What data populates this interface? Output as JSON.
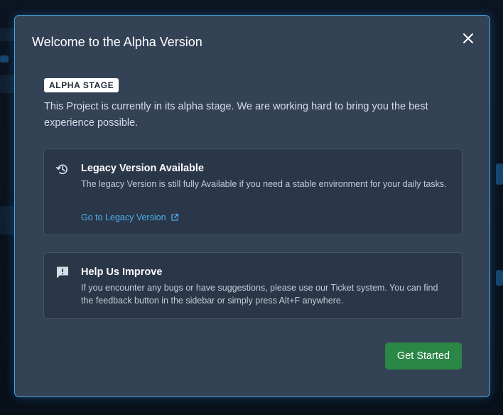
{
  "modal": {
    "title": "Welcome to the Alpha Version",
    "badge": "ALPHA STAGE",
    "intro": "This Project is currently in its alpha stage. We are working hard to bring you the best experience possible.",
    "close_icon": "close-icon"
  },
  "cards": {
    "legacy": {
      "icon": "history-icon",
      "title": "Legacy Version Available",
      "text": "The legacy Version is still fully Available if you need a stable environment for your daily tasks.",
      "link_label": "Go to Legacy Version",
      "link_icon": "external-link-icon"
    },
    "feedback": {
      "icon": "feedback-icon",
      "title": "Help Us Improve",
      "text": "If you encounter any bugs or have suggestions, please use our Ticket system. You can find the feedback button in the sidebar or simply press Alt+F anywhere."
    }
  },
  "actions": {
    "primary_label": "Get Started"
  },
  "colors": {
    "modal_bg": "#344256",
    "modal_border": "#4aa3df",
    "card_bg": "#2a3748",
    "link": "#4db0ee",
    "primary_button": "#2a8746"
  }
}
